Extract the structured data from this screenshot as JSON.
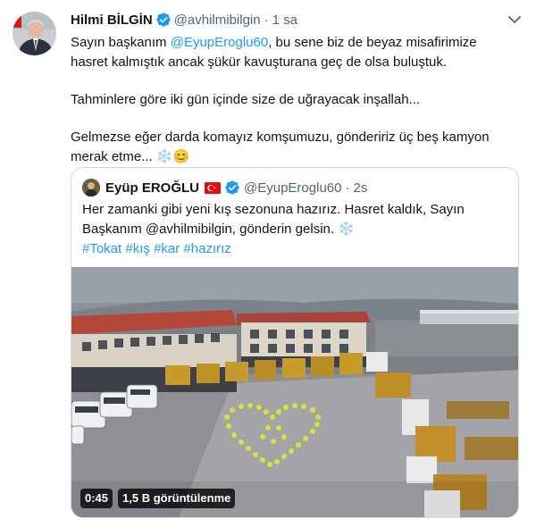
{
  "tweet": {
    "display_name": "Hilmi BİLGİN",
    "handle": "@avhilmibilgin",
    "separator": "·",
    "time": "1 sa",
    "lines": {
      "l1_pre": "Sayın başkanım ",
      "l1_mention": "@EyupEroglu60",
      "l1_post": ", bu sene biz de beyaz misafirimize",
      "l2": "hasret kalmıştık ancak şükür kavuşturana geç de olsa buluştuk.",
      "p2": "Tahminlere göre iki gün içinde size de uğrayacak inşallah...",
      "p3_l1": "Gelmezse eğer darda komayız komşumuzu, göndeririz üç beş kamyon",
      "p3_l2": "merak etme... ",
      "p3_emoji_snow": "❄️",
      "p3_emoji_smile": "😊"
    }
  },
  "quote": {
    "display_name": "Eyüp EROĞLU",
    "handle": "@EyupEroglu60",
    "separator": "·",
    "time": "2s",
    "lines": {
      "l1": "Her zamanki gibi yeni kış sezonuna hazırız. Hasret kaldık, Sayın",
      "l2": "Başkanım @avhilmibilgin, gönderin gelsin. ",
      "l2_snow": "❄️",
      "hashtags": [
        "#Tokat",
        "#kış",
        "#kar",
        "#hazırız"
      ]
    },
    "video": {
      "duration": "0:45",
      "views": "1,5 B görüntülenme"
    }
  },
  "icons": {
    "verified": "verified-badge-icon",
    "more": "more-options-icon",
    "flag": "turkey-flag-icon"
  },
  "colors": {
    "link": "#1d9bf0",
    "verified": "#1d9bf0",
    "muted": "#536471",
    "border": "#cfd9de"
  }
}
